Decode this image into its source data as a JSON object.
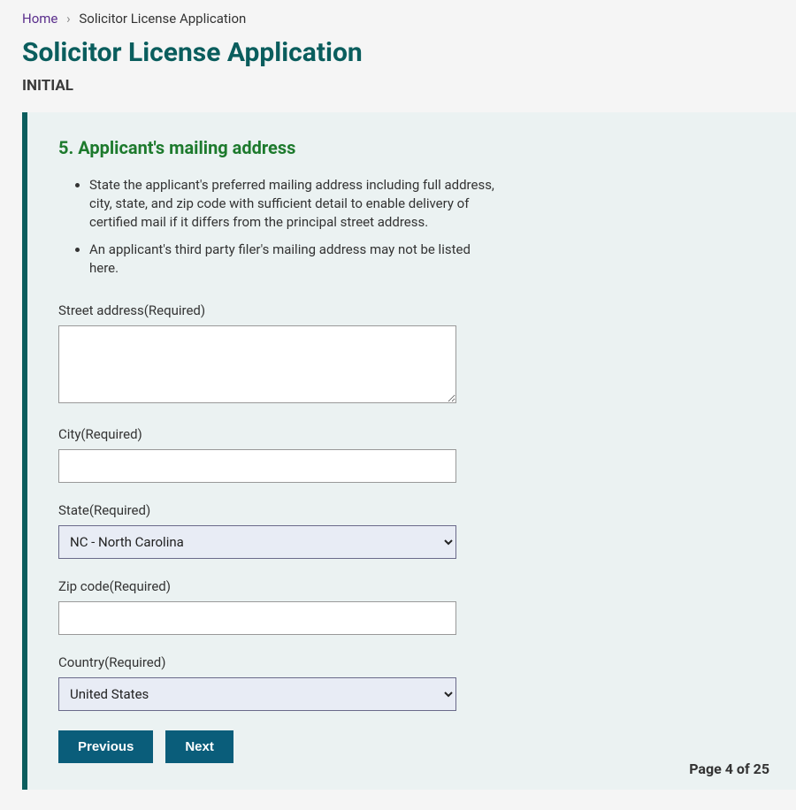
{
  "breadcrumb": {
    "home": "Home",
    "current": "Solicitor License Application"
  },
  "page_title": "Solicitor License Application",
  "subtitle": "INITIAL",
  "section": {
    "title": "5. Applicant's mailing address",
    "instructions": [
      "State the applicant's preferred mailing address including full address, city, state, and zip code with sufficient detail to enable delivery of certified mail if it differs from the principal street address.",
      "An applicant's third party filer's mailing address may not be listed here."
    ]
  },
  "form": {
    "street": {
      "label": "Street address(Required)",
      "value": ""
    },
    "city": {
      "label": "City(Required)",
      "value": ""
    },
    "state": {
      "label": "State(Required)",
      "selected": "NC - North Carolina"
    },
    "zip": {
      "label": "Zip code(Required)",
      "value": ""
    },
    "country": {
      "label": "Country(Required)",
      "selected": "United States"
    }
  },
  "buttons": {
    "previous": "Previous",
    "next": "Next"
  },
  "page_indicator": "Page 4 of 25"
}
